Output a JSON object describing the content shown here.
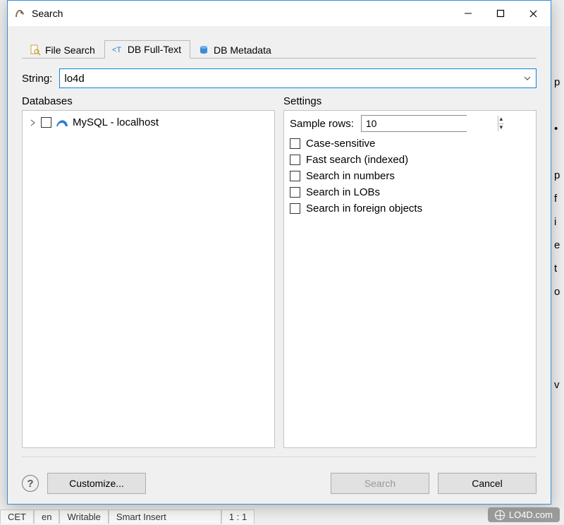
{
  "window": {
    "title": "Search"
  },
  "tabs": [
    {
      "label": "File Search"
    },
    {
      "label": "DB Full-Text"
    },
    {
      "label": "DB Metadata"
    }
  ],
  "string_row": {
    "label": "String:",
    "value": "lo4d"
  },
  "databases": {
    "title": "Databases",
    "items": [
      {
        "label": "MySQL - localhost"
      }
    ]
  },
  "settings": {
    "title": "Settings",
    "sample_rows_label": "Sample rows:",
    "sample_rows_value": "10",
    "checks": [
      {
        "label": "Case-sensitive"
      },
      {
        "label": "Fast search (indexed)"
      },
      {
        "label": "Search in numbers"
      },
      {
        "label": "Search in LOBs"
      },
      {
        "label": "Search in foreign objects"
      }
    ]
  },
  "footer": {
    "customize": "Customize...",
    "search": "Search",
    "cancel": "Cancel"
  },
  "status": {
    "cet": "CET",
    "lang": "en",
    "writable": "Writable",
    "insert": "Smart Insert",
    "pos": "1 : 1"
  },
  "watermark": "LO4D.com"
}
